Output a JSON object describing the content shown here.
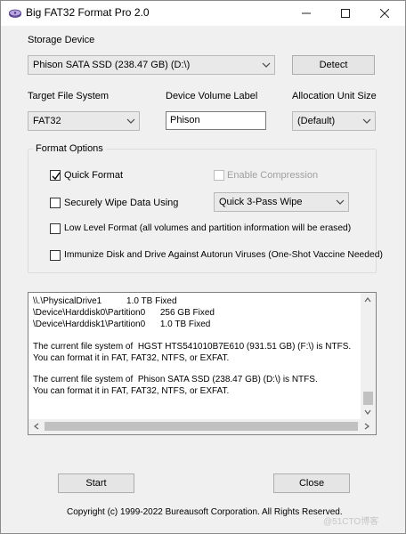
{
  "window": {
    "title": "Big FAT32 Format Pro 2.0"
  },
  "device": {
    "label": "Storage Device",
    "selected": "Phison SATA SSD (238.47 GB) (D:\\)",
    "detect_label": "Detect"
  },
  "filesystem": {
    "label": "Target File System",
    "selected": "FAT32"
  },
  "volume": {
    "label": "Device Volume Label",
    "value": "Phison"
  },
  "allocation": {
    "label": "Allocation Unit Size",
    "selected": "(Default)"
  },
  "options": {
    "title": "Format Options",
    "quick_format": {
      "label": "Quick Format",
      "checked": true
    },
    "compression": {
      "label": "Enable Compression",
      "checked": false,
      "disabled": true
    },
    "secure_wipe": {
      "label": "Securely Wipe Data Using",
      "checked": false,
      "method": "Quick 3-Pass Wipe"
    },
    "low_level": {
      "label": "Low Level Format (all volumes and partition information will be erased)",
      "checked": false
    },
    "immunize": {
      "label": "Immunize Disk and Drive Against Autorun Viruses (One-Shot Vaccine Needed)",
      "checked": false
    }
  },
  "log": {
    "lines": [
      "\\\\.\\PhysicalDrive1          1.0 TB Fixed",
      "\\Device\\Harddisk0\\Partition0      256 GB Fixed",
      "\\Device\\Harddisk1\\Partition0      1.0 TB Fixed",
      "",
      "The current file system of  HGST HTS541010B7E610 (931.51 GB) (F:\\) is NTFS.",
      "You can format it in FAT, FAT32, NTFS, or EXFAT.",
      "",
      "The current file system of  Phison SATA SSD (238.47 GB) (D:\\) is NTFS.",
      "You can format it in FAT, FAT32, NTFS, or EXFAT."
    ]
  },
  "actions": {
    "start_label": "Start",
    "close_label": "Close"
  },
  "footer": {
    "copyright": "Copyright (c) 1999-2022 Bureausoft Corporation. All Rights Reserved.",
    "watermark": "@51CTO博客"
  }
}
